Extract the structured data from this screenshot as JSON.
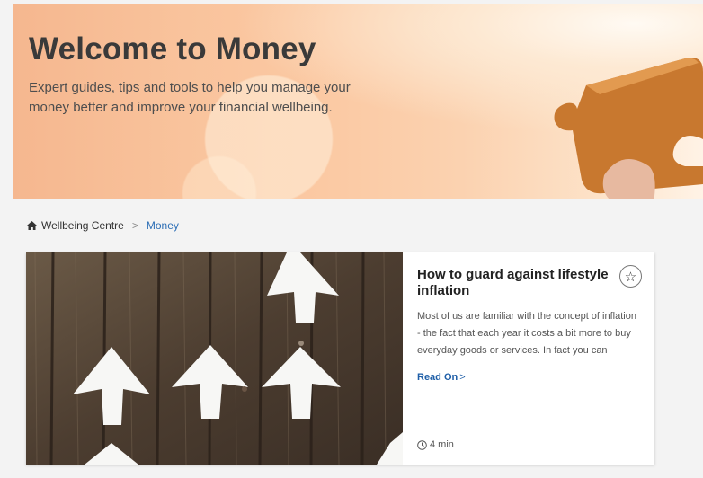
{
  "hero": {
    "title": "Welcome to Money",
    "subtitle": "Expert guides, tips and tools to help you manage your money better and improve your financial wellbeing."
  },
  "breadcrumb": {
    "home_icon": "home-icon",
    "home_label": "Wellbeing Centre",
    "separator": ">",
    "current_label": "Money"
  },
  "article": {
    "title": "How to guard against lifestyle inflation",
    "excerpt": "Most of us are familiar with the concept of inflation - the fact that each year it costs a bit more to buy everyday goods or services. In fact you can probably",
    "read_on_label": "Read On",
    "read_on_chevron": ">",
    "duration": "4 min",
    "favorite_icon": "star-icon",
    "clock_icon": "clock-icon",
    "image_icon": "arrows-on-wood-image"
  },
  "colors": {
    "link": "#1f5fa8",
    "breadcrumb_current": "#2a6db5",
    "page_background": "#f3f3f3"
  }
}
